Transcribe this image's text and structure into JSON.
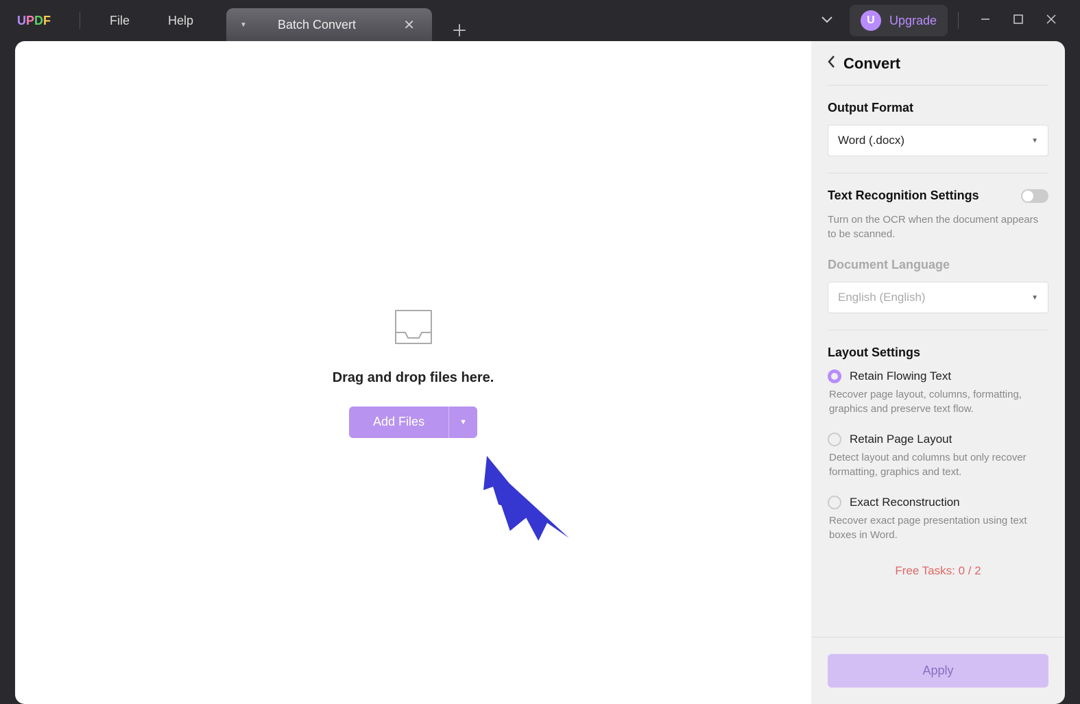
{
  "menu": {
    "file": "File",
    "help": "Help"
  },
  "tab": {
    "title": "Batch Convert"
  },
  "upgrade": {
    "label": "Upgrade",
    "icon_letter": "U"
  },
  "dropzone": {
    "text": "Drag and drop files here.",
    "add_files": "Add Files"
  },
  "sidebar": {
    "title": "Convert",
    "output_format": {
      "label": "Output Format",
      "value": "Word (.docx)"
    },
    "ocr": {
      "label": "Text Recognition Settings",
      "hint": "Turn on the OCR when the document appears to be scanned."
    },
    "doc_lang": {
      "label": "Document Language",
      "value": "English (English)"
    },
    "layout": {
      "label": "Layout Settings",
      "options": [
        {
          "label": "Retain Flowing Text",
          "desc": "Recover page layout, columns, formatting, graphics and preserve text flow."
        },
        {
          "label": "Retain Page Layout",
          "desc": "Detect layout and columns but only recover formatting, graphics and text."
        },
        {
          "label": "Exact Reconstruction",
          "desc": "Recover exact page presentation using text boxes in Word."
        }
      ]
    },
    "free_tasks": "Free Tasks: 0 / 2",
    "apply": "Apply"
  }
}
